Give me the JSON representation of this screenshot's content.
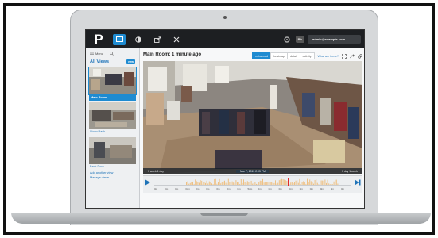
{
  "app": {
    "title": "Main Room: 1 minute ago",
    "user_badge": "Bh",
    "user_email": "admin@example.com"
  },
  "sidebar": {
    "menu_label": "Menu",
    "heading": "All Views",
    "new_badge": "new",
    "views": [
      {
        "label": "Main Room",
        "selected": true
      },
      {
        "label": "Show Rack",
        "selected": false
      },
      {
        "label": "Back Door",
        "selected": false
      }
    ],
    "links": [
      "Add another view",
      "Manage views"
    ]
  },
  "toolbar": {
    "tabs": [
      "enhanced",
      "heatmap",
      "detail",
      "activity"
    ],
    "active_tab": "enhanced",
    "link": "What are these?"
  },
  "video": {
    "left_controls": "1 week   1 day",
    "timestamp": "Mar 7, 2013       2:03 PM",
    "right_controls": "1 day   1 week"
  },
  "timeline": {
    "ticks": [
      "0m",
      "0m",
      "0m",
      "3pm",
      "0m",
      "0m",
      "0m",
      "0m",
      "0m",
      "5pm",
      "0m",
      "0m",
      "0m",
      "0m",
      "0m",
      "0m",
      "0m",
      "0m",
      "0m"
    ]
  },
  "colors": {
    "accent": "#1e8bd1",
    "topbar": "#1d1f22",
    "activity": "#f0a23a",
    "marker": "#e0282a"
  }
}
